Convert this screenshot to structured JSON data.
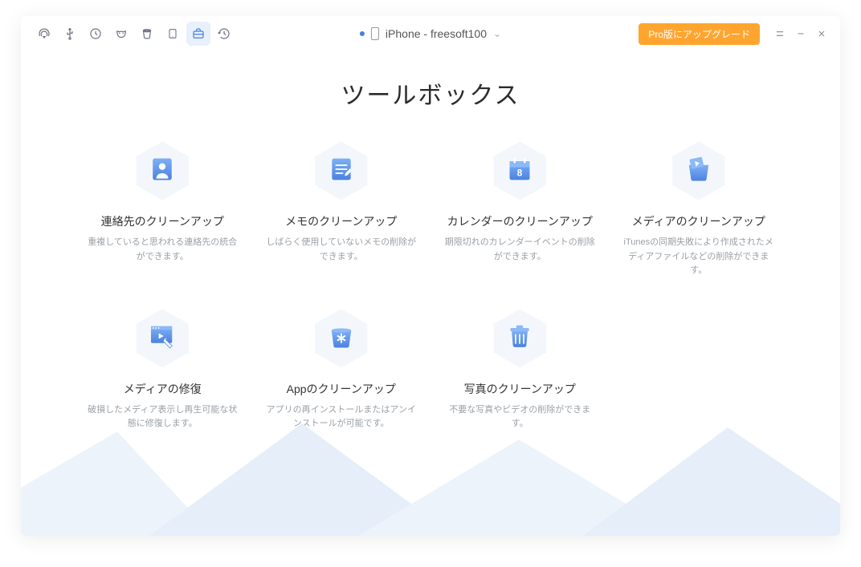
{
  "header": {
    "device_label": "iPhone - freesoft100",
    "pro_button": "Pro版にアップグレード"
  },
  "title": "ツールボックス",
  "tools": [
    {
      "title": "連絡先のクリーンアップ",
      "desc": "重複していると思われる連絡先の統合ができます。"
    },
    {
      "title": "メモのクリーンアップ",
      "desc": "しばらく使用していないメモの削除ができます。"
    },
    {
      "title": "カレンダーのクリーンアップ",
      "desc": "期限切れのカレンダーイベントの削除ができます。"
    },
    {
      "title": "メディアのクリーンアップ",
      "desc": "iTunesの同期失敗により作成されたメディアファイルなどの削除ができます。"
    },
    {
      "title": "メディアの修復",
      "desc": "破損したメディア表示し再生可能な状態に修復します。"
    },
    {
      "title": "Appのクリーンアップ",
      "desc": "アプリの再インストールまたはアンインストールが可能です。"
    },
    {
      "title": "写真のクリーンアップ",
      "desc": "不要な写真やビデオの削除ができます。"
    }
  ]
}
